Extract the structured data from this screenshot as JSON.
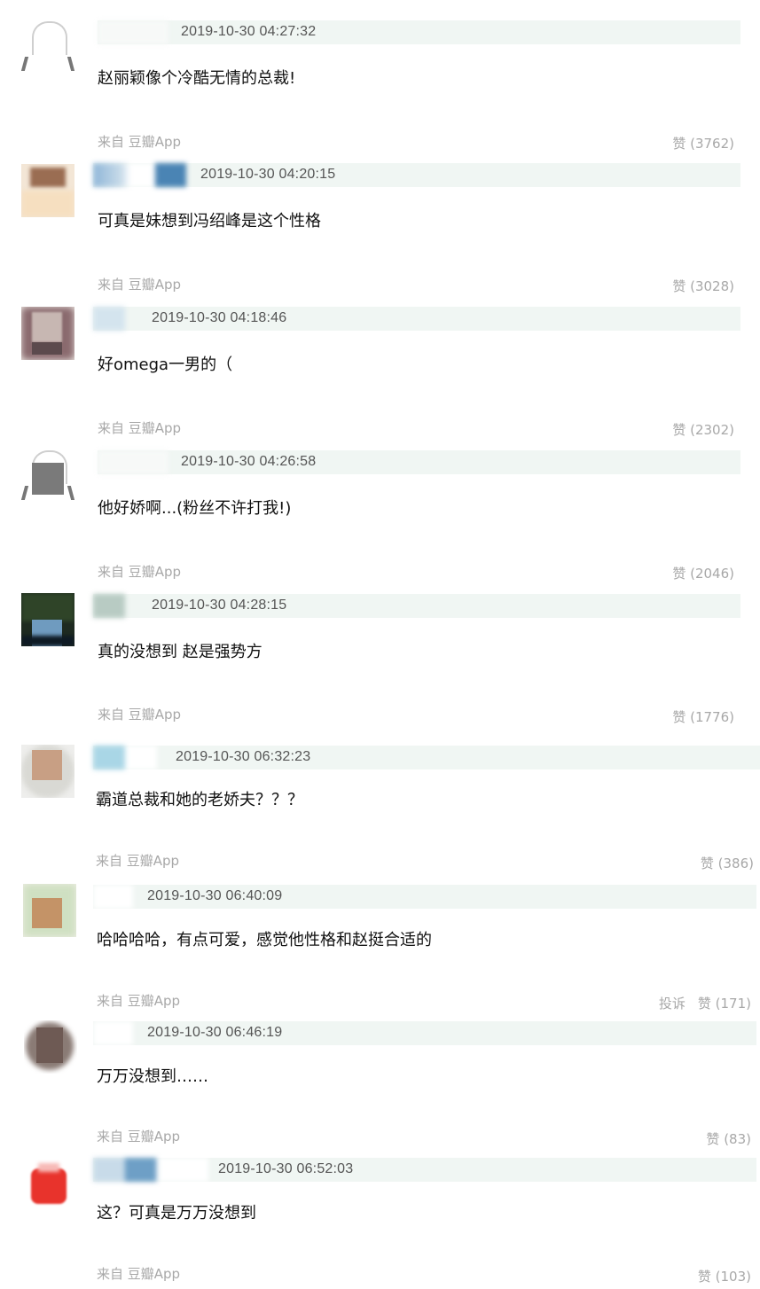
{
  "comments": [
    {
      "time": "2019-10-30 04:27:32",
      "text": "赵丽颖像个冷酷无情的总裁!",
      "source": "来自 豆瓣App",
      "like_label": "赞",
      "like_count": "(3762)"
    },
    {
      "time": "2019-10-30 04:20:15",
      "text": "可真是妹想到冯绍峰是这个性格",
      "source": "来自 豆瓣App",
      "like_label": "赞",
      "like_count": "(3028)"
    },
    {
      "time": "2019-10-30 04:18:46",
      "text": "好omega一男的（",
      "source": "来自 豆瓣App",
      "like_label": "赞",
      "like_count": "(2302)"
    },
    {
      "time": "2019-10-30 04:26:58",
      "text": "他好娇啊...(粉丝不许打我!)",
      "source": "来自 豆瓣App",
      "like_label": "赞",
      "like_count": "(2046)"
    },
    {
      "time": "2019-10-30 04:28:15",
      "text": "真的没想到 赵是强势方",
      "source": "来自 豆瓣App",
      "like_label": "赞",
      "like_count": "(1776)"
    },
    {
      "time": "2019-10-30 06:32:23",
      "text": "霸道总裁和她的老娇夫？？？",
      "source": "来自 豆瓣App",
      "like_label": "赞",
      "like_count": "(386)"
    },
    {
      "time": "2019-10-30 06:40:09",
      "text": "哈哈哈哈，有点可爱，感觉他性格和赵挺合适的",
      "source": "来自 豆瓣App",
      "report_label": "投诉",
      "like_label": "赞",
      "like_count": "(171)"
    },
    {
      "time": "2019-10-30 06:46:19",
      "text": "万万没想到……",
      "source": "来自 豆瓣App",
      "like_label": "赞",
      "like_count": "(83)"
    },
    {
      "time": "2019-10-30 06:52:03",
      "text": "这？可真是万万没想到",
      "source": "来自 豆瓣App",
      "like_label": "赞",
      "like_count": "(103)"
    }
  ]
}
